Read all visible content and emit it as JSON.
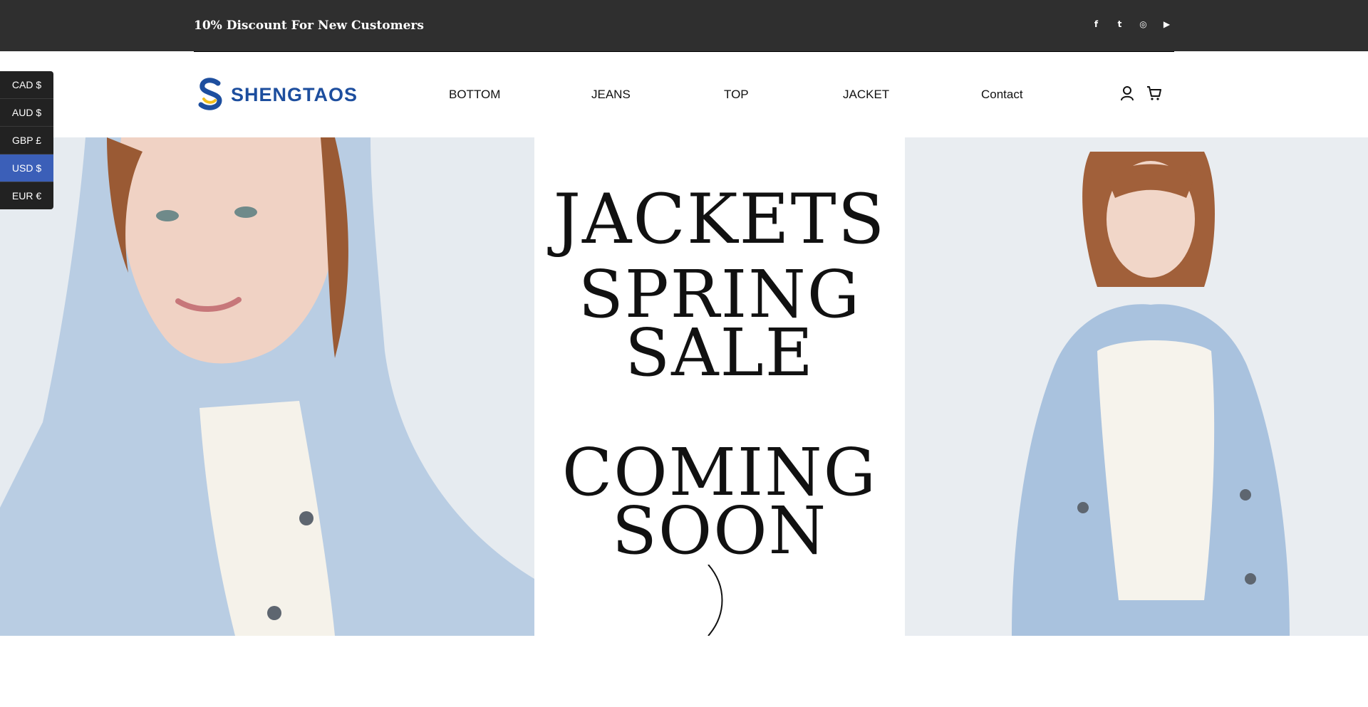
{
  "topbar": {
    "promo": "10% Discount For New Customers",
    "social": [
      {
        "icon": "facebook-icon",
        "glyph": "f"
      },
      {
        "icon": "twitter-icon",
        "glyph": "t"
      },
      {
        "icon": "instagram-icon",
        "glyph": "◎"
      },
      {
        "icon": "youtube-icon",
        "glyph": "▶"
      }
    ]
  },
  "brand": {
    "name": "SHENGTAOS",
    "color": "#1d4e9e",
    "accent": "#f2c01e"
  },
  "nav": {
    "items": [
      "BOTTOM",
      "JEANS",
      "TOP",
      "JACKET",
      "Contact"
    ]
  },
  "currency": {
    "options": [
      "CAD $",
      "AUD $",
      "GBP £",
      "USD $",
      "EUR €"
    ],
    "selected": "USD $"
  },
  "hero": {
    "line1": "JACKETS",
    "line2a": "SPRING",
    "line2b": "SALE",
    "line3a": "COMING",
    "line3b": "SOON"
  }
}
